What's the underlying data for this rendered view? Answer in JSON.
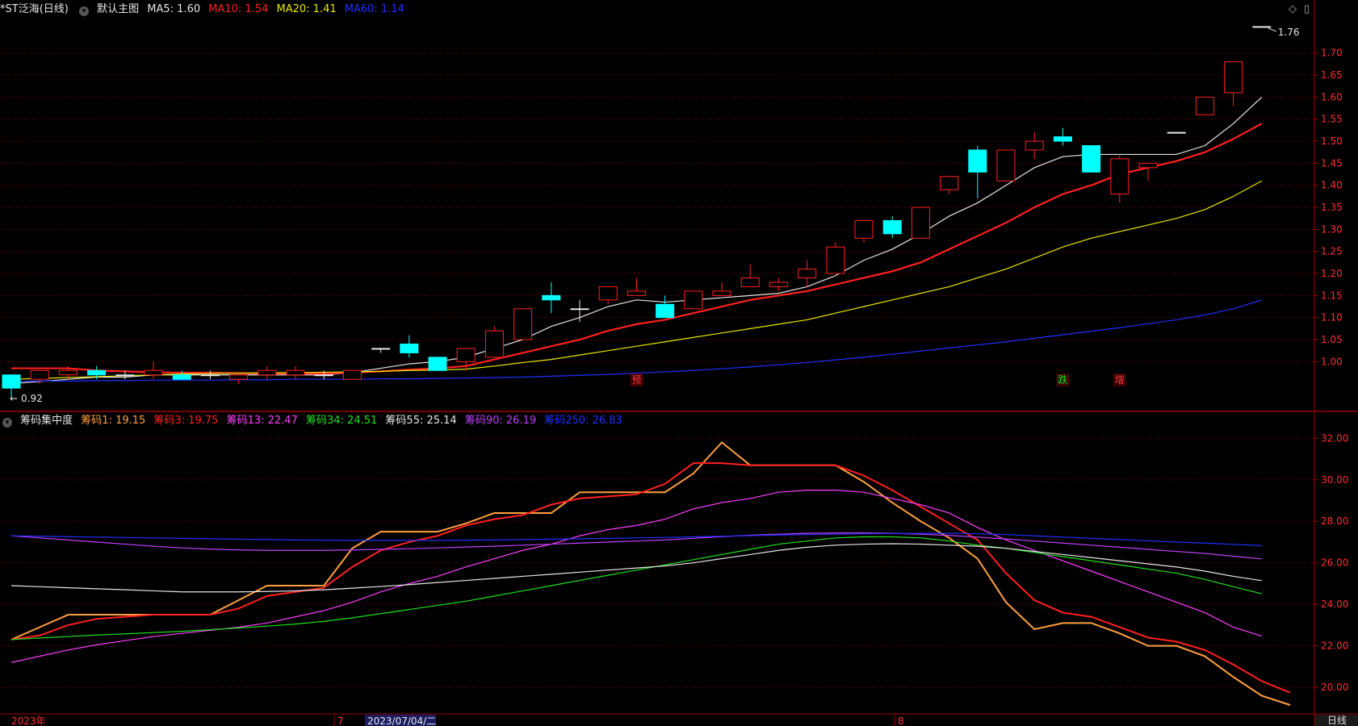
{
  "header": {
    "stock": "*ST泛海(日线)",
    "template": "默认主图",
    "ma": [
      {
        "label": "MA5: 1.60",
        "color": "#e6e6e6"
      },
      {
        "label": "MA10: 1.54",
        "color": "#ff2020"
      },
      {
        "label": "MA20: 1.41",
        "color": "#e8e800"
      },
      {
        "label": "MA60: 1.14",
        "color": "#2030ff"
      }
    ]
  },
  "lower_header": {
    "indicator": "筹码集中度",
    "items": [
      {
        "label": "筹码1: 19.15",
        "color": "#ffa040"
      },
      {
        "label": "筹码3: 19.75",
        "color": "#ff2020"
      },
      {
        "label": "筹码13: 22.47",
        "color": "#ff40ff"
      },
      {
        "label": "筹码34: 24.51",
        "color": "#20e020"
      },
      {
        "label": "筹码55: 25.14",
        "color": "#e6e6e6"
      },
      {
        "label": "筹码90: 26.19",
        "color": "#c040ff"
      },
      {
        "label": "筹码250: 26.83",
        "color": "#2030ff"
      }
    ]
  },
  "bottom": {
    "year": "2023年",
    "m7": "7",
    "cursor_date": "2023/07/04/二",
    "m8": "8",
    "tab": "日线"
  },
  "colors": {
    "up": "#ff2020",
    "down": "#00ffff",
    "grid": "#600000"
  },
  "chart_data": [
    {
      "type": "candlestick",
      "title": "*ST泛海(日线)",
      "y_ticks": [
        "1.00",
        "1.05",
        "1.10",
        "1.15",
        "1.20",
        "1.25",
        "1.30",
        "1.35",
        "1.40",
        "1.45",
        "1.50",
        "1.55",
        "1.60",
        "1.65",
        "1.70"
      ],
      "ylim": [
        0.9,
        1.78
      ],
      "max_label": "1.76",
      "min_label": "0.92",
      "event_markers": [
        {
          "index": 22,
          "text": "预"
        },
        {
          "index": 37,
          "text": "跌"
        },
        {
          "index": 39,
          "text": "增"
        }
      ],
      "candles": [
        {
          "o": 0.97,
          "h": 0.97,
          "l": 0.92,
          "c": 0.94
        },
        {
          "o": 0.96,
          "h": 0.98,
          "l": 0.95,
          "c": 0.98
        },
        {
          "o": 0.97,
          "h": 0.99,
          "l": 0.96,
          "c": 0.98
        },
        {
          "o": 0.98,
          "h": 0.99,
          "l": 0.96,
          "c": 0.97
        },
        {
          "o": 0.97,
          "h": 0.98,
          "l": 0.96,
          "c": 0.97
        },
        {
          "o": 0.97,
          "h": 1.0,
          "l": 0.96,
          "c": 0.98
        },
        {
          "o": 0.97,
          "h": 0.98,
          "l": 0.96,
          "c": 0.96
        },
        {
          "o": 0.97,
          "h": 0.98,
          "l": 0.96,
          "c": 0.97
        },
        {
          "o": 0.96,
          "h": 0.97,
          "l": 0.95,
          "c": 0.97
        },
        {
          "o": 0.97,
          "h": 0.99,
          "l": 0.96,
          "c": 0.98
        },
        {
          "o": 0.97,
          "h": 0.99,
          "l": 0.96,
          "c": 0.98
        },
        {
          "o": 0.97,
          "h": 0.98,
          "l": 0.96,
          "c": 0.97
        },
        {
          "o": 0.96,
          "h": 0.98,
          "l": 0.96,
          "c": 0.98
        },
        {
          "o": 1.03,
          "h": 1.03,
          "l": 1.02,
          "c": 1.03
        },
        {
          "o": 1.04,
          "h": 1.06,
          "l": 1.01,
          "c": 1.02
        },
        {
          "o": 1.01,
          "h": 1.01,
          "l": 0.98,
          "c": 0.98
        },
        {
          "o": 1.0,
          "h": 1.03,
          "l": 0.98,
          "c": 1.03
        },
        {
          "o": 1.01,
          "h": 1.08,
          "l": 1.01,
          "c": 1.07
        },
        {
          "o": 1.05,
          "h": 1.12,
          "l": 1.05,
          "c": 1.12
        },
        {
          "o": 1.15,
          "h": 1.18,
          "l": 1.11,
          "c": 1.14
        },
        {
          "o": 1.12,
          "h": 1.14,
          "l": 1.09,
          "c": 1.12
        },
        {
          "o": 1.14,
          "h": 1.17,
          "l": 1.13,
          "c": 1.17
        },
        {
          "o": 1.15,
          "h": 1.19,
          "l": 1.15,
          "c": 1.16
        },
        {
          "o": 1.13,
          "h": 1.15,
          "l": 1.1,
          "c": 1.1
        },
        {
          "o": 1.12,
          "h": 1.16,
          "l": 1.12,
          "c": 1.16
        },
        {
          "o": 1.15,
          "h": 1.18,
          "l": 1.15,
          "c": 1.16
        },
        {
          "o": 1.17,
          "h": 1.22,
          "l": 1.17,
          "c": 1.19
        },
        {
          "o": 1.17,
          "h": 1.19,
          "l": 1.16,
          "c": 1.18
        },
        {
          "o": 1.19,
          "h": 1.23,
          "l": 1.17,
          "c": 1.21
        },
        {
          "o": 1.2,
          "h": 1.27,
          "l": 1.2,
          "c": 1.26
        },
        {
          "o": 1.28,
          "h": 1.32,
          "l": 1.27,
          "c": 1.32
        },
        {
          "o": 1.32,
          "h": 1.33,
          "l": 1.28,
          "c": 1.29
        },
        {
          "o": 1.28,
          "h": 1.35,
          "l": 1.28,
          "c": 1.35
        },
        {
          "o": 1.39,
          "h": 1.42,
          "l": 1.38,
          "c": 1.42
        },
        {
          "o": 1.48,
          "h": 1.49,
          "l": 1.37,
          "c": 1.43
        },
        {
          "o": 1.41,
          "h": 1.48,
          "l": 1.41,
          "c": 1.48
        },
        {
          "o": 1.48,
          "h": 1.52,
          "l": 1.46,
          "c": 1.5
        },
        {
          "o": 1.51,
          "h": 1.53,
          "l": 1.49,
          "c": 1.5
        },
        {
          "o": 1.49,
          "h": 1.49,
          "l": 1.43,
          "c": 1.43
        },
        {
          "o": 1.38,
          "h": 1.47,
          "l": 1.36,
          "c": 1.46
        },
        {
          "o": 1.44,
          "h": 1.45,
          "l": 1.41,
          "c": 1.45
        },
        {
          "o": 1.52,
          "h": 1.52,
          "l": 1.52,
          "c": 1.52
        },
        {
          "o": 1.56,
          "h": 1.6,
          "l": 1.56,
          "c": 1.6
        },
        {
          "o": 1.61,
          "h": 1.68,
          "l": 1.58,
          "c": 1.68
        },
        {
          "o": 1.76,
          "h": 1.76,
          "l": 1.76,
          "c": 1.76
        }
      ],
      "series": [
        {
          "name": "MA5",
          "color": "#e6e6e6",
          "values": [
            0.95,
            0.955,
            0.96,
            0.965,
            0.965,
            0.97,
            0.97,
            0.97,
            0.97,
            0.97,
            0.97,
            0.97,
            0.975,
            0.985,
            0.995,
            1.0,
            1.01,
            1.03,
            1.05,
            1.08,
            1.1,
            1.125,
            1.14,
            1.135,
            1.14,
            1.145,
            1.15,
            1.155,
            1.17,
            1.195,
            1.23,
            1.255,
            1.29,
            1.33,
            1.36,
            1.4,
            1.44,
            1.465,
            1.47,
            1.47,
            1.47,
            1.47,
            1.49,
            1.54,
            1.6
          ]
        },
        {
          "name": "MA10",
          "color": "#ff2020",
          "values": [
            0.985,
            0.985,
            0.985,
            0.98,
            0.978,
            0.976,
            0.975,
            0.975,
            0.974,
            0.973,
            0.973,
            0.973,
            0.975,
            0.978,
            0.982,
            0.985,
            0.99,
            1.005,
            1.02,
            1.035,
            1.05,
            1.07,
            1.085,
            1.095,
            1.11,
            1.125,
            1.14,
            1.15,
            1.16,
            1.175,
            1.19,
            1.205,
            1.225,
            1.255,
            1.285,
            1.315,
            1.35,
            1.38,
            1.4,
            1.425,
            1.44,
            1.455,
            1.475,
            1.505,
            1.54
          ]
        },
        {
          "name": "MA20",
          "color": "#e8e800",
          "values": [
            0.96,
            0.962,
            0.964,
            0.966,
            0.968,
            0.97,
            0.972,
            0.973,
            0.974,
            0.975,
            0.975,
            0.976,
            0.977,
            0.978,
            0.98,
            0.981,
            0.983,
            0.99,
            0.998,
            1.005,
            1.015,
            1.025,
            1.035,
            1.045,
            1.055,
            1.065,
            1.075,
            1.085,
            1.095,
            1.11,
            1.125,
            1.14,
            1.155,
            1.17,
            1.19,
            1.21,
            1.235,
            1.26,
            1.28,
            1.295,
            1.31,
            1.325,
            1.345,
            1.375,
            1.41
          ]
        },
        {
          "name": "MA60",
          "color": "#2030ff",
          "values": [
            0.955,
            0.956,
            0.956,
            0.957,
            0.957,
            0.958,
            0.958,
            0.958,
            0.959,
            0.959,
            0.96,
            0.96,
            0.96,
            0.961,
            0.961,
            0.962,
            0.963,
            0.964,
            0.965,
            0.967,
            0.969,
            0.971,
            0.974,
            0.977,
            0.98,
            0.984,
            0.988,
            0.993,
            0.998,
            1.004,
            1.01,
            1.017,
            1.024,
            1.031,
            1.038,
            1.045,
            1.053,
            1.061,
            1.069,
            1.077,
            1.086,
            1.095,
            1.106,
            1.12,
            1.14
          ]
        }
      ]
    },
    {
      "type": "line",
      "title": "筹码集中度",
      "y_ticks": [
        "20.00",
        "22.00",
        "24.00",
        "26.00",
        "28.00",
        "30.00",
        "32.00"
      ],
      "ylim": [
        18.8,
        32.4
      ],
      "series": [
        {
          "name": "筹码1",
          "color": "#ffa040",
          "values": [
            22.3,
            22.9,
            23.5,
            23.5,
            23.5,
            23.5,
            23.5,
            23.5,
            24.2,
            24.9,
            24.9,
            24.9,
            26.7,
            27.5,
            27.5,
            27.5,
            27.9,
            28.4,
            28.4,
            28.4,
            29.4,
            29.4,
            29.4,
            29.4,
            30.3,
            31.8,
            30.7,
            30.7,
            30.7,
            30.7,
            29.9,
            28.9,
            28.0,
            27.2,
            26.2,
            24.1,
            22.8,
            23.1,
            23.1,
            22.6,
            22.0,
            22.0,
            21.5,
            20.5,
            19.6,
            19.15
          ]
        },
        {
          "name": "筹码3",
          "color": "#ff2020",
          "values": [
            22.3,
            22.5,
            23.0,
            23.3,
            23.4,
            23.5,
            23.5,
            23.5,
            23.8,
            24.4,
            24.6,
            24.8,
            25.8,
            26.6,
            27.0,
            27.3,
            27.8,
            28.1,
            28.3,
            28.8,
            29.1,
            29.2,
            29.3,
            29.8,
            30.8,
            30.8,
            30.7,
            30.7,
            30.7,
            30.7,
            30.2,
            29.5,
            28.7,
            27.9,
            27.1,
            25.5,
            24.2,
            23.6,
            23.4,
            22.9,
            22.4,
            22.2,
            21.8,
            21.1,
            20.3,
            19.75
          ]
        },
        {
          "name": "筹码13",
          "color": "#ff40ff",
          "values": [
            21.2,
            21.5,
            21.8,
            22.05,
            22.25,
            22.45,
            22.6,
            22.75,
            22.9,
            23.1,
            23.4,
            23.7,
            24.1,
            24.6,
            25.0,
            25.35,
            25.8,
            26.2,
            26.6,
            26.9,
            27.3,
            27.6,
            27.8,
            28.1,
            28.6,
            28.9,
            29.1,
            29.4,
            29.5,
            29.5,
            29.4,
            29.1,
            28.8,
            28.4,
            27.7,
            27.1,
            26.6,
            26.1,
            25.6,
            25.1,
            24.6,
            24.1,
            23.6,
            22.9,
            22.47
          ]
        },
        {
          "name": "筹码34",
          "color": "#20e020",
          "values": [
            22.3,
            22.38,
            22.45,
            22.52,
            22.58,
            22.64,
            22.7,
            22.78,
            22.86,
            22.95,
            23.05,
            23.18,
            23.35,
            23.55,
            23.75,
            23.95,
            24.15,
            24.4,
            24.65,
            24.9,
            25.15,
            25.4,
            25.65,
            25.9,
            26.15,
            26.4,
            26.65,
            26.9,
            27.05,
            27.2,
            27.25,
            27.25,
            27.2,
            27.05,
            26.85,
            26.7,
            26.5,
            26.3,
            26.1,
            25.9,
            25.7,
            25.5,
            25.2,
            24.85,
            24.51
          ]
        },
        {
          "name": "筹码55",
          "color": "#e6e6e6",
          "values": [
            24.9,
            24.85,
            24.8,
            24.75,
            24.7,
            24.65,
            24.6,
            24.6,
            24.6,
            24.62,
            24.65,
            24.7,
            24.78,
            24.86,
            24.95,
            25.05,
            25.15,
            25.25,
            25.35,
            25.45,
            25.55,
            25.65,
            25.75,
            25.85,
            26.0,
            26.2,
            26.4,
            26.6,
            26.75,
            26.85,
            26.9,
            26.92,
            26.9,
            26.85,
            26.8,
            26.7,
            26.55,
            26.4,
            26.25,
            26.1,
            25.95,
            25.8,
            25.6,
            25.35,
            25.14
          ]
        },
        {
          "name": "筹码90",
          "color": "#c040ff",
          "values": [
            27.3,
            27.2,
            27.1,
            27.0,
            26.9,
            26.8,
            26.72,
            26.66,
            26.62,
            26.6,
            26.6,
            26.6,
            26.62,
            26.65,
            26.68,
            26.72,
            26.76,
            26.8,
            26.85,
            26.9,
            26.95,
            27.0,
            27.05,
            27.1,
            27.18,
            27.26,
            27.33,
            27.38,
            27.42,
            27.44,
            27.44,
            27.42,
            27.38,
            27.32,
            27.24,
            27.15,
            27.05,
            26.95,
            26.85,
            26.75,
            26.65,
            26.55,
            26.45,
            26.32,
            26.19
          ]
        },
        {
          "name": "筹码250",
          "color": "#2030ff",
          "values": [
            27.3,
            27.28,
            27.26,
            27.24,
            27.22,
            27.2,
            27.18,
            27.16,
            27.14,
            27.12,
            27.1,
            27.09,
            27.08,
            27.08,
            27.08,
            27.08,
            27.09,
            27.1,
            27.12,
            27.14,
            27.16,
            27.18,
            27.2,
            27.22,
            27.25,
            27.28,
            27.31,
            27.34,
            27.36,
            27.38,
            27.4,
            27.41,
            27.42,
            27.42,
            27.4,
            27.36,
            27.3,
            27.24,
            27.18,
            27.12,
            27.06,
            27.0,
            26.95,
            26.89,
            26.83
          ]
        }
      ]
    }
  ]
}
